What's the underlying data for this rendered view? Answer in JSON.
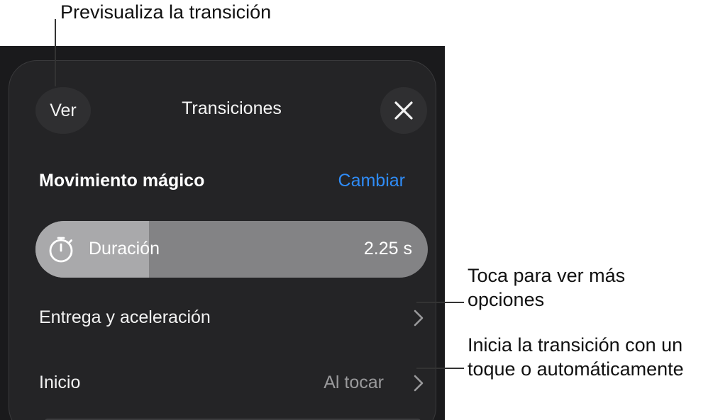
{
  "callouts": {
    "preview": "Previsualiza la transición",
    "options_line1": "Toca para ver más",
    "options_line2": "opciones",
    "start_line1": "Inicia la transición con un",
    "start_line2": "toque o automáticamente"
  },
  "panel": {
    "ver_label": "Ver",
    "title": "Transiciones",
    "close_icon": "close-icon",
    "section_title": "Movimiento mágico",
    "change_label": "Cambiar",
    "duration": {
      "label": "Duración",
      "value": "2.25 s",
      "fill_fraction": 0.29,
      "icon": "stopwatch-icon"
    },
    "rows": [
      {
        "label": "Entrega y aceleración",
        "value": "",
        "icon": "chevron-right-icon"
      },
      {
        "label": "Inicio",
        "value": "Al tocar",
        "icon": "chevron-right-icon"
      }
    ]
  },
  "colors": {
    "accent": "#2f8cf7",
    "panel_background": "#242426",
    "slider_track": "#838385",
    "slider_fill": "#a9a9ab"
  }
}
